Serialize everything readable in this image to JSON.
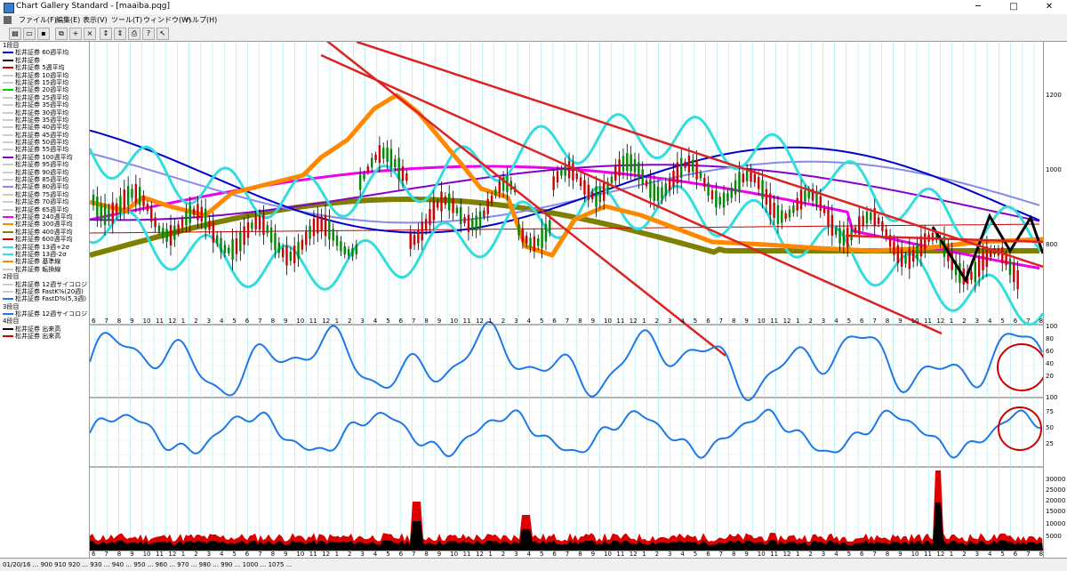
{
  "window": {
    "title": "Chart Gallery Standard - [maaiba.pqg]",
    "minimize": "─",
    "maximize": "□",
    "close": "✕"
  },
  "menu": [
    "ファイル(F)",
    "編集(E)",
    "表示(V)",
    "ツール(T)",
    "ウィンドウ(W)",
    "ヘルプ(H)"
  ],
  "toolbar_icons": [
    "open-icon",
    "folder-icon",
    "save-icon",
    "copy-icon",
    "add-icon",
    "delete-icon",
    "scale-icon",
    "scale2-icon",
    "print-icon",
    "help-icon",
    "pointer-help-icon"
  ],
  "legend": {
    "sections": [
      {
        "label": "1段目",
        "items": [
          {
            "label": "松井証券 60週平均",
            "color": "#0000cc"
          },
          {
            "label": "松井証券",
            "color": "#000000"
          },
          {
            "label": "松井証券 5週平均",
            "color": "#cc0000"
          },
          {
            "label": "松井証券 10週平均",
            "color": "#cccccc"
          },
          {
            "label": "松井証券 15週平均",
            "color": "#cccccc"
          },
          {
            "label": "松井証券 20週平均",
            "color": "#00cc00"
          },
          {
            "label": "松井証券 25週平均",
            "color": "#cccccc"
          },
          {
            "label": "松井証券 35週平均",
            "color": "#cccccc"
          },
          {
            "label": "松井証券 30週平均",
            "color": "#cccccc"
          },
          {
            "label": "松井証券 35週平均",
            "color": "#cccccc"
          },
          {
            "label": "松井証券 40週平均",
            "color": "#cccccc"
          },
          {
            "label": "松井証券 45週平均",
            "color": "#cccccc"
          },
          {
            "label": "松井証券 50週平均",
            "color": "#cccccc"
          },
          {
            "label": "松井証券 55週平均",
            "color": "#cccccc"
          },
          {
            "label": "松井証券 100週平均",
            "color": "#8800cc"
          },
          {
            "label": "松井証券 95週平均",
            "color": "#cccccc"
          },
          {
            "label": "松井証券 90週平均",
            "color": "#cccccc"
          },
          {
            "label": "松井証券 85週平均",
            "color": "#cccccc"
          },
          {
            "label": "松井証券 80週平均",
            "color": "#8888ee"
          },
          {
            "label": "松井証券 75週平均",
            "color": "#cccccc"
          },
          {
            "label": "松井証券 70週平均",
            "color": "#cccccc"
          },
          {
            "label": "松井証券 65週平均",
            "color": "#cccccc"
          },
          {
            "label": "松井証券 240週平均",
            "color": "#ee00ee"
          },
          {
            "label": "松井証券 300週平均",
            "color": "#ff8800"
          },
          {
            "label": "松井証券 400週平均",
            "color": "#808000"
          },
          {
            "label": "松井証券 600週平均",
            "color": "#cc0000"
          },
          {
            "label": "松井証券 13週+2σ",
            "color": "#33dddd"
          },
          {
            "label": "松井証券 13週-2σ",
            "color": "#33dddd"
          },
          {
            "label": "松井証券 基準線",
            "color": "#ff8800"
          },
          {
            "label": "松井証券 転換線",
            "color": "#cccccc"
          }
        ]
      },
      {
        "label": "2段目",
        "items": [
          {
            "label": "松井証券 12週サイコロジ",
            "color": "#cccccc"
          },
          {
            "label": "松井証券 FastK%(20週)",
            "color": "#cccccc"
          },
          {
            "label": "松井証券 FastD%(5,3週)",
            "color": "#1e78e6"
          }
        ]
      },
      {
        "label": "3段目",
        "items": [
          {
            "label": "松井証券 12週サイコロジ",
            "color": "#1e78e6"
          }
        ]
      },
      {
        "label": "4段目",
        "items": [
          {
            "label": "松井証券 出来高",
            "color": "#000000"
          },
          {
            "label": "松井証券 出来高",
            "color": "#cc0000"
          }
        ]
      }
    ]
  },
  "axis": {
    "price_ticks": [
      "1200",
      "1000",
      "800"
    ],
    "osc_ticks": [
      "100",
      "80",
      "60",
      "40",
      "20"
    ],
    "psy_ticks": [
      "100",
      "75",
      "50",
      "25"
    ],
    "volume_ticks": [
      "30000",
      "25000",
      "20000",
      "15000",
      "10000",
      "5000"
    ]
  },
  "x_axis_labels": [
    "6",
    "7",
    "8",
    "9",
    "10",
    "11",
    "12",
    "1",
    "2",
    "3",
    "4",
    "5",
    "6",
    "7",
    "8",
    "9",
    "10",
    "11",
    "12",
    "1",
    "2",
    "3",
    "4",
    "5",
    "6",
    "7",
    "8",
    "9",
    "10",
    "11",
    "12",
    "1",
    "2",
    "3",
    "4",
    "5",
    "6",
    "7",
    "8",
    "9",
    "10",
    "11",
    "12",
    "1",
    "2",
    "3",
    "4",
    "5",
    "6",
    "7",
    "8",
    "9",
    "10",
    "11",
    "12",
    "1",
    "2",
    "3",
    "4",
    "5",
    "6",
    "7",
    "8",
    "9",
    "10",
    "11",
    "12",
    "1",
    "2",
    "3",
    "4",
    "5",
    "6",
    "7",
    "8"
  ],
  "statusbar": "01/20/16 ... 900 910 920 ... 930 ... 940 ... 950 ... 960 ... 970 ... 980 ... 990 ... 1000 ... 1075 ..."
}
